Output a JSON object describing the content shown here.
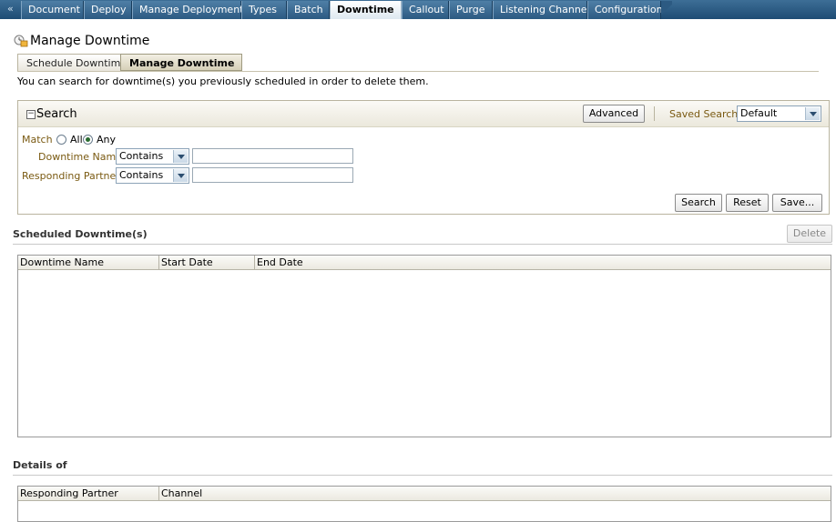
{
  "nav": {
    "arrow": "«",
    "tabs": [
      "Document",
      "Deploy",
      "Manage Deployments",
      "Types",
      "Batch",
      "Downtime",
      "Callout",
      "Purge",
      "Listening Channel",
      "Configuration"
    ],
    "active_tab": "Downtime"
  },
  "page": {
    "title": "Manage Downtime",
    "subtabs": [
      "Schedule Downtime",
      "Manage Downtime"
    ],
    "active_subtab": "Manage Downtime",
    "instruction": "You can search for downtime(s) you previously scheduled in order to delete them."
  },
  "search": {
    "title": "Search",
    "advanced_label": "Advanced",
    "saved_search_label": "Saved Search",
    "saved_search_value": "Default",
    "match_label": "Match",
    "match_all": "All",
    "match_any": "Any",
    "match_selected": "Any",
    "fields": [
      {
        "label": "Downtime Name",
        "operator": "Contains",
        "value": ""
      },
      {
        "label": "Responding Partner",
        "operator": "Contains",
        "value": ""
      }
    ],
    "buttons": {
      "search": "Search",
      "reset": "Reset",
      "save": "Save..."
    }
  },
  "scheduled": {
    "title": "Scheduled Downtime(s)",
    "delete_label": "Delete",
    "columns": [
      "Downtime Name",
      "Start Date",
      "End Date"
    ],
    "rows": []
  },
  "details": {
    "title": "Details of",
    "columns": [
      "Responding Partner",
      "Channel"
    ],
    "rows": []
  },
  "colors": {
    "nav_bg": "#1e4c74",
    "label_gold": "#7a5a12",
    "panel_border": "#b9b49f"
  }
}
